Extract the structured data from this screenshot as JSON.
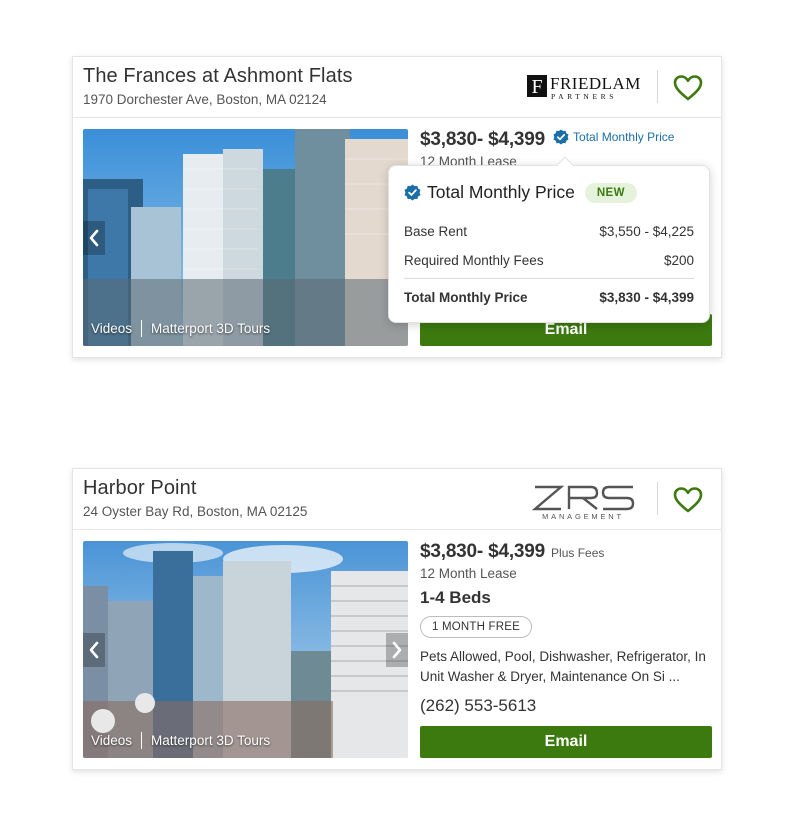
{
  "listings": [
    {
      "name": "The Frances at Ashmont Flats",
      "address": "1970 Dorchester Ave, Boston, MA 02124",
      "logo": {
        "name": "FRIEDLAM",
        "sub": "PARTNERS",
        "mark": "F"
      },
      "price": "$3,830- $4,399",
      "price_note": "Total Monthly Price",
      "lease": "12 Month Lease",
      "media": [
        "Videos",
        "Matterport 3D Tours"
      ],
      "cta": "Email",
      "favorite_icon": "heart-outline-icon",
      "popover": {
        "title": "Total Monthly Price",
        "badge": "NEW",
        "rows": [
          {
            "label": "Base Rent",
            "value": "$3,550 - $4,225"
          },
          {
            "label": "Required Monthly Fees",
            "value": "$200"
          }
        ],
        "total": {
          "label": "Total Monthly Price",
          "value": "$3,830 - $4,399"
        }
      }
    },
    {
      "name": "Harbor Point",
      "address": "24 Oyster Bay Rd, Boston, MA 02125",
      "logo": {
        "name": "ZRS",
        "sub": "MANAGEMENT"
      },
      "price": "$3,830- $4,399",
      "price_note": "Plus Fees",
      "lease": "12 Month Lease",
      "beds": "1-4 Beds",
      "special": "1 MONTH FREE",
      "amenities": "Pets Allowed,  Pool, Dishwasher, Refrigerator, In Unit Washer & Dryer, Maintenance On Si ...",
      "phone": "(262) 553-5613",
      "media": [
        "Videos",
        "Matterport 3D Tours"
      ],
      "cta": "Email",
      "favorite_icon": "heart-outline-icon"
    }
  ],
  "colors": {
    "brand_green": "#3c7a0f",
    "link_blue": "#1b6fa8",
    "badge_bg": "#e6f3dc"
  }
}
